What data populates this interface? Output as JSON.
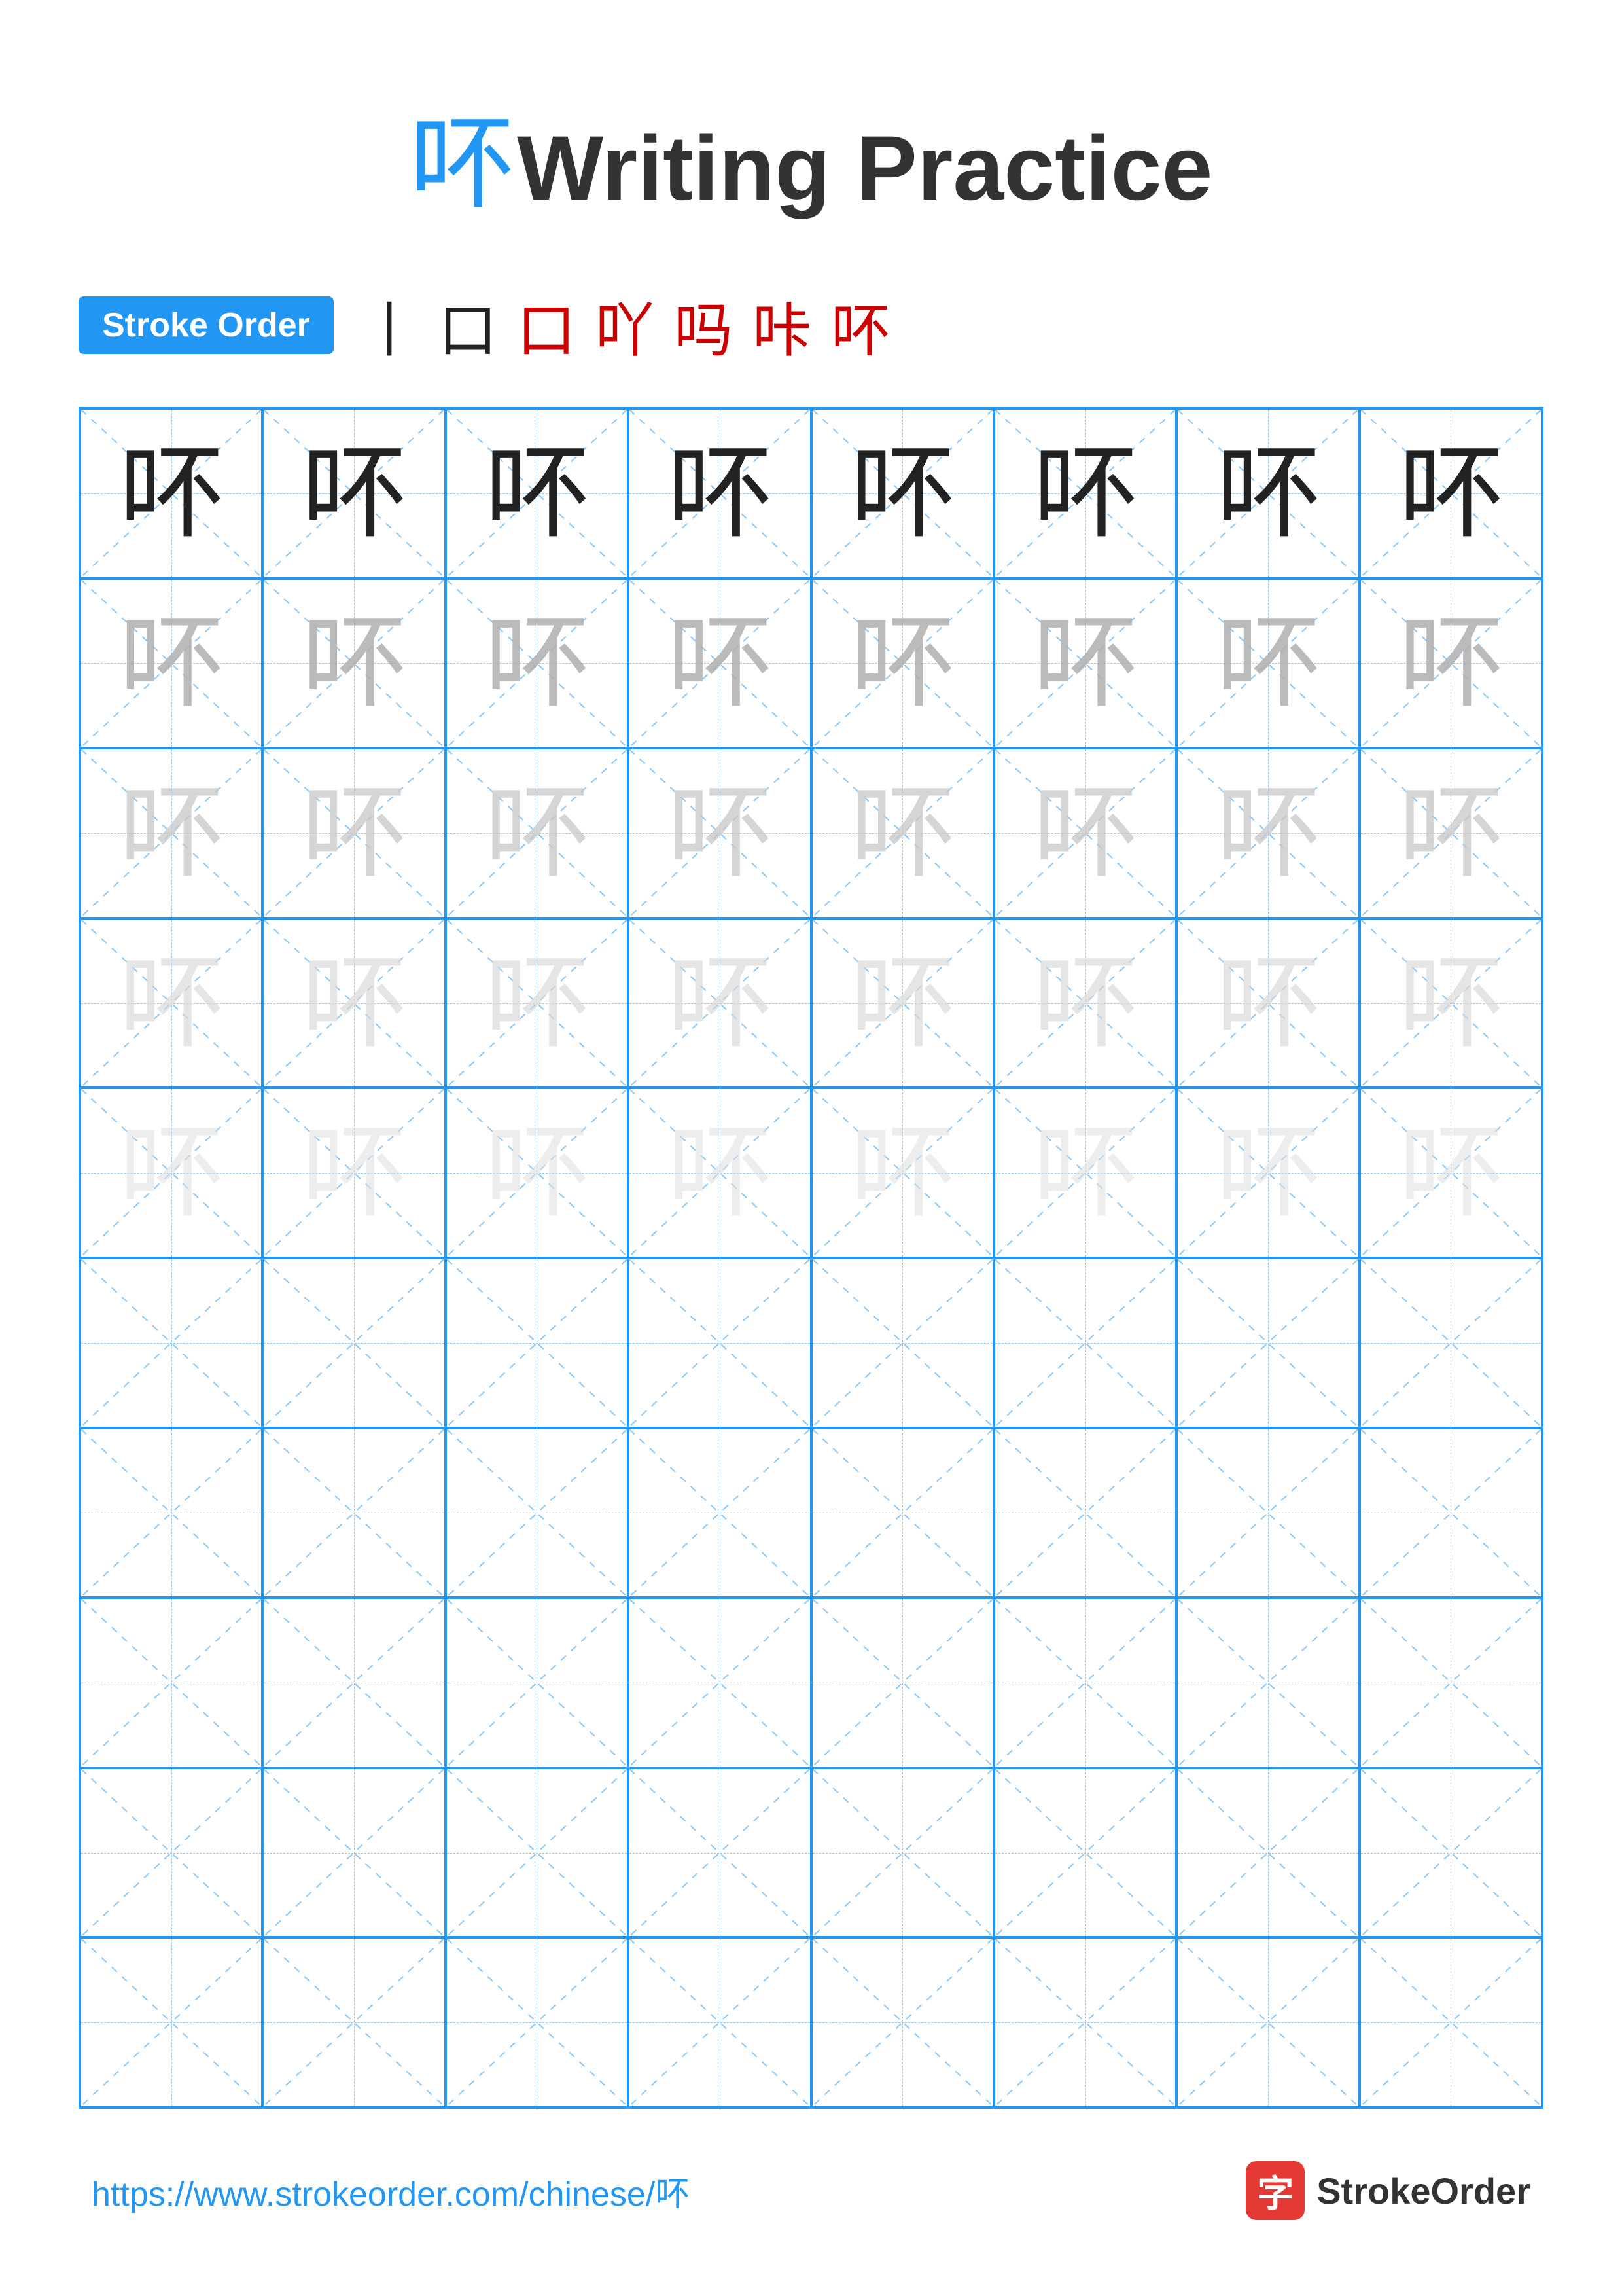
{
  "title": {
    "chinese_char": "吥",
    "text": "Writing Practice"
  },
  "stroke_order": {
    "badge_label": "Stroke Order",
    "strokes": [
      "丨",
      "口",
      "口",
      "吖",
      "吗",
      "咔",
      "吥"
    ]
  },
  "grid": {
    "cols": 8,
    "rows": 10,
    "char": "吥",
    "filled_rows": 5,
    "opacities": [
      "dark",
      "light1",
      "light2",
      "light3",
      "light4"
    ]
  },
  "footer": {
    "url": "https://www.strokeorder.com/chinese/吥",
    "logo_icon": "字",
    "logo_text": "StrokeOrder"
  }
}
